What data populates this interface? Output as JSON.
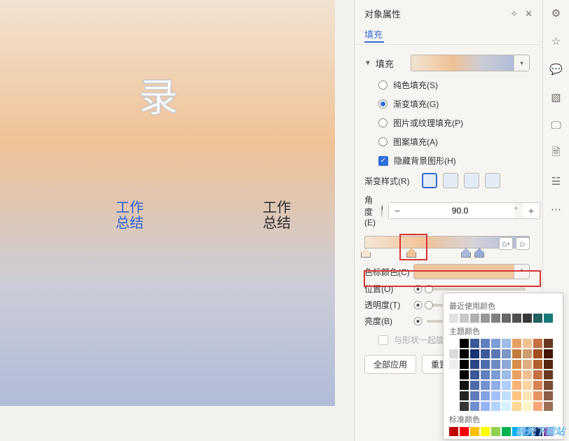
{
  "header": {
    "title": "对象属性",
    "pin": "固定",
    "close": "关闭"
  },
  "tab": "填充",
  "fill": {
    "section": "填充",
    "options": {
      "solid": "纯色填充(S)",
      "gradient": "渐变填充(G)",
      "picture": "图片或纹理填充(P)",
      "pattern": "图案填充(A)",
      "hidebg": "隐藏背景图形(H)"
    },
    "selected": "gradient"
  },
  "gradient": {
    "styleLabel": "渐变样式(R)",
    "angleLabel": "角度(E)",
    "angle": "90.0",
    "angleUnit": "°",
    "stopColorLabel": "色标颜色(C)",
    "positionLabel": "位置(O)",
    "transparencyLabel": "透明度(T)",
    "brightnessLabel": "亮度(B)",
    "syncChk": "与形状一起旋转",
    "addStop": "＋",
    "delStop": "－"
  },
  "footer": {
    "applyAll": "全部应用",
    "reset": "重置"
  },
  "palette": {
    "recent": "最近使用颜色",
    "theme": "主题颜色",
    "standard": "标准颜色"
  },
  "slide": {
    "bigChar": "录",
    "txtA": "工作\n总结",
    "txtB": "工作\n总结"
  },
  "watermark": "极光下载站",
  "chart_data": null
}
